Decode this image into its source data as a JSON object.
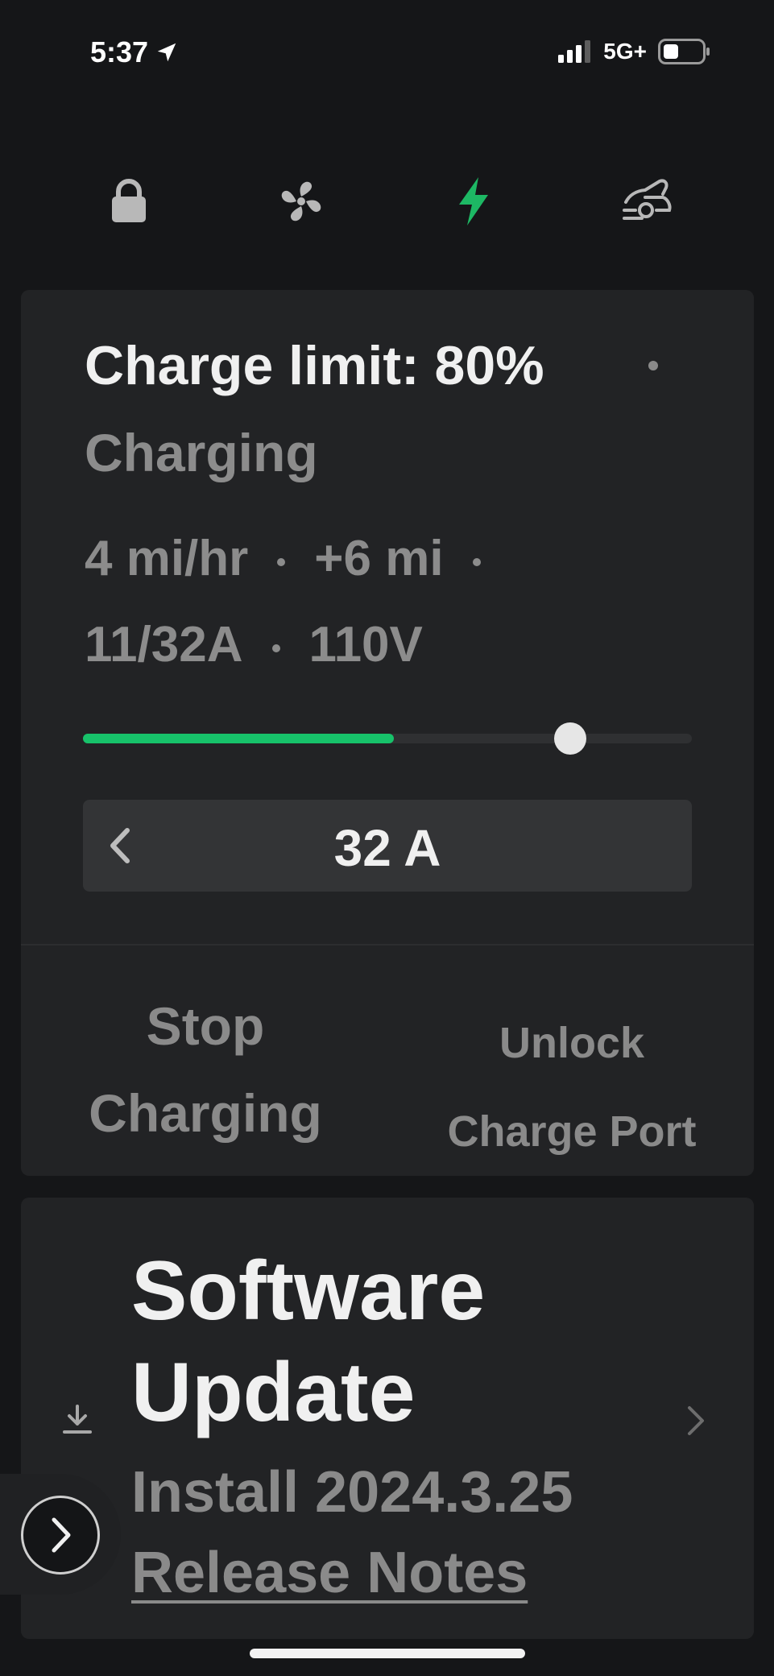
{
  "status_bar": {
    "time": "5:37",
    "network": "5G+"
  },
  "nav": {
    "icons": [
      "lock-icon",
      "fan-icon",
      "bolt-icon",
      "car-icon"
    ],
    "active": "bolt-icon",
    "active_color": "#1db864"
  },
  "charging": {
    "title": "Charge limit: 80%",
    "state": "Charging",
    "rate": "4 mi/hr",
    "added": "+6 mi",
    "current": "11/32A",
    "voltage": "110V",
    "progress_fraction": 0.51,
    "charge_limit_fraction": 0.8,
    "accent_color": "#17c26a",
    "amp_value": "32 A",
    "stop_button": [
      "Stop",
      "Charging"
    ],
    "unlock_button": [
      "Unlock",
      "Charge Port"
    ]
  },
  "software_update": {
    "title_line1": "Software",
    "title_line2": "Update",
    "install_text": "Install 2024.3.25",
    "release_notes": "Release Notes"
  }
}
